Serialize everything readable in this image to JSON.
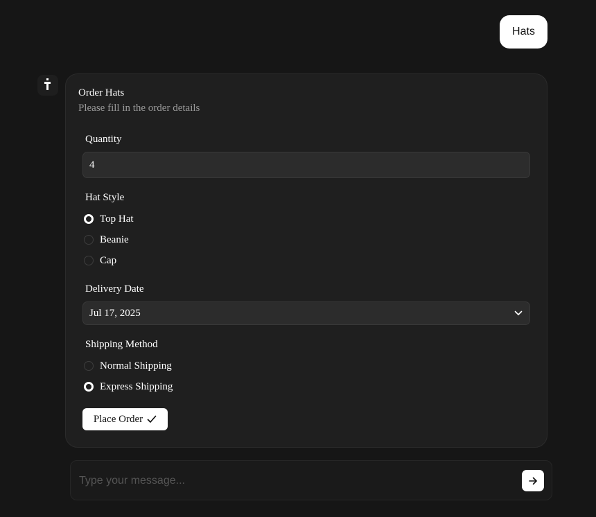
{
  "user_message": "Hats",
  "form": {
    "title": "Order Hats",
    "subtitle": "Please fill in the order details",
    "quantity": {
      "label": "Quantity",
      "value": "4"
    },
    "hat_style": {
      "label": "Hat Style",
      "options": [
        "Top Hat",
        "Beanie",
        "Cap"
      ],
      "selected": "Top Hat"
    },
    "delivery_date": {
      "label": "Delivery Date",
      "value": "Jul 17, 2025"
    },
    "shipping_method": {
      "label": "Shipping Method",
      "options": [
        "Normal Shipping",
        "Express Shipping"
      ],
      "selected": "Express Shipping"
    },
    "submit_label": "Place Order"
  },
  "composer": {
    "placeholder": "Type your message..."
  },
  "icons": {
    "avatar": "assistant-logo-icon",
    "select": "chevron-down-icon",
    "submit": "check-icon",
    "send": "arrow-right-icon"
  },
  "colors": {
    "background": "#161616",
    "card": "#1f1f1f",
    "input": "#2c2c2c",
    "accent": "#ffffff",
    "muted_text": "#9a9a9a"
  }
}
